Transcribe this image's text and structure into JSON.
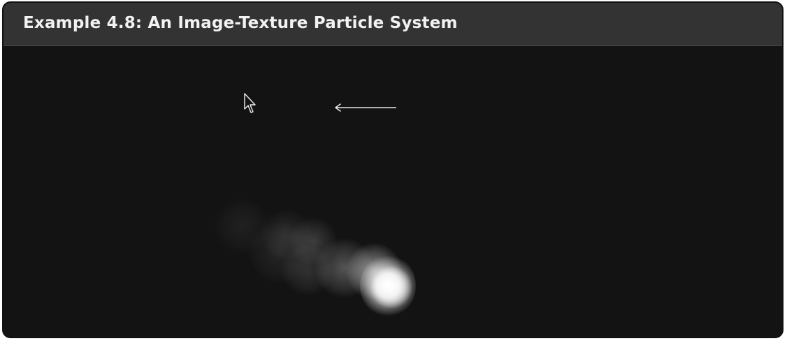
{
  "window": {
    "title": "Example 4.8: An Image-Texture Particle System"
  },
  "canvas": {
    "cursor_icon": "mouse-pointer-icon",
    "arrow_icon": "arrow-left-icon",
    "effect": "smoke-particles",
    "colors": {
      "title_bar": "#333333",
      "background": "#131313",
      "title_text": "#f2f2f2",
      "particle": "#ffffff"
    }
  }
}
